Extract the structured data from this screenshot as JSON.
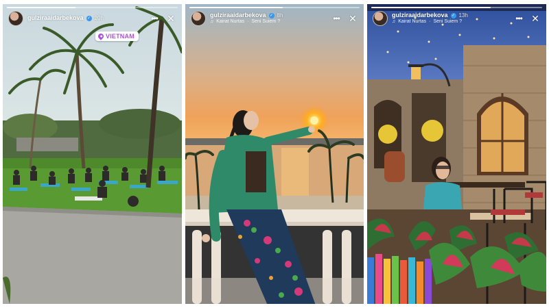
{
  "stories": [
    {
      "username": "gulziraaidarbekova",
      "time": "20h",
      "music": null,
      "location_sticker": "VIETNAM"
    },
    {
      "username": "gulziraaidarbekova",
      "time": "8h",
      "music": {
        "artist": "Kairat Nurtas",
        "song": "Seni Suiem ?"
      }
    },
    {
      "username": "gulziraaidarbekova",
      "time": "13h",
      "music": {
        "artist": "Kairat Nurtas",
        "song": "Seni Suiem ?"
      }
    }
  ],
  "icons": {
    "verified": "verified-badge-icon",
    "menu": "more-options-icon",
    "close": "close-icon",
    "music": "music-note-icon",
    "location": "location-pin-icon"
  },
  "colors": {
    "verified": "#3897f0",
    "location_sticker": "#b14fd6"
  }
}
